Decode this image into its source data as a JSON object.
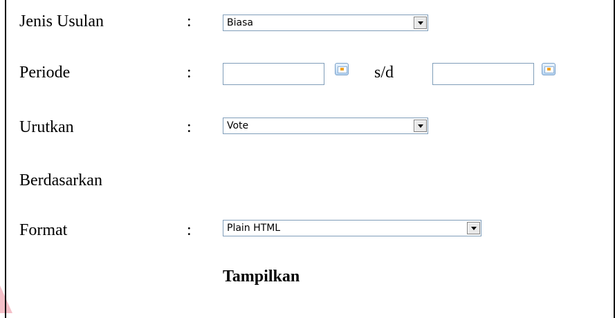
{
  "form": {
    "jenis_usulan": {
      "label": "Jenis Usulan",
      "colon": ":",
      "selected": "Biasa"
    },
    "periode": {
      "label": "Periode",
      "colon": ":",
      "from_value": "",
      "separator": "s/d",
      "to_value": "",
      "calendar_icon": "calendar-icon"
    },
    "urutkan": {
      "label": "Urutkan",
      "colon": ":",
      "selected": "Vote"
    },
    "berdasarkan": {
      "label": "Berdasarkan"
    },
    "format": {
      "label": "Format",
      "colon": ":",
      "selected": "Plain HTML"
    },
    "submit_label": "Tampilkan"
  },
  "colors": {
    "border": "#000000",
    "input_border": "#7f9db9",
    "accent_corner": "#f4c0c8"
  }
}
